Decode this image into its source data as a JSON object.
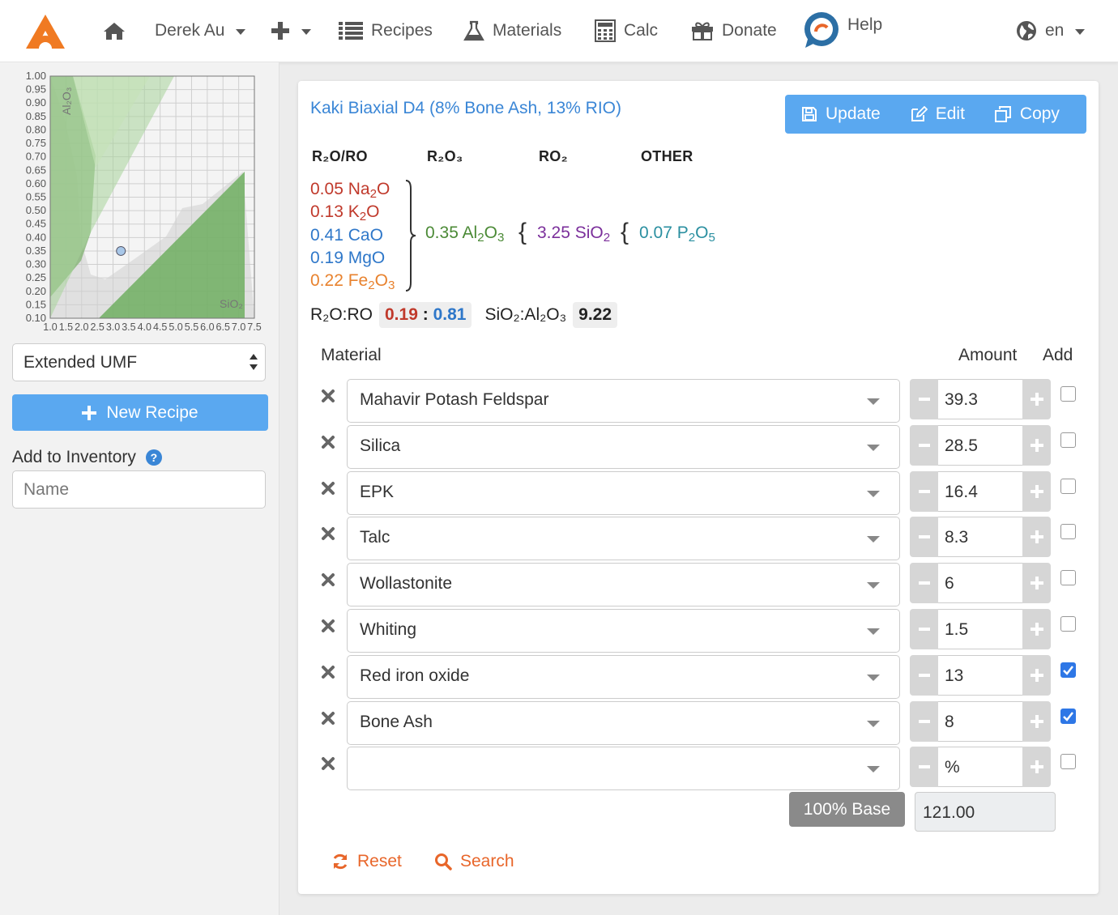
{
  "nav": {
    "user": "Derek Au",
    "recipes": "Recipes",
    "materials": "Materials",
    "calc": "Calc",
    "donate": "Donate",
    "help": "Help",
    "lang": "en",
    "icons": [
      "logo-icon",
      "home-icon",
      "plus-icon",
      "list-icon",
      "flask-icon",
      "calculator-icon",
      "gift-icon",
      "chat-icon",
      "globe-icon"
    ]
  },
  "sidebar": {
    "chart_y_ticks": [
      "1.00",
      "0.95",
      "0.90",
      "0.85",
      "0.80",
      "0.75",
      "0.70",
      "0.65",
      "0.60",
      "0.55",
      "0.50",
      "0.45",
      "0.40",
      "0.35",
      "0.30",
      "0.25",
      "0.20",
      "0.15",
      "0.10"
    ],
    "chart_x_ticks": [
      "1.0",
      "1.5",
      "2.0",
      "2.5",
      "3.0",
      "3.5",
      "4.0",
      "4.5",
      "5.0",
      "5.5",
      "6.0",
      "6.5",
      "7.0",
      "7.5"
    ],
    "chart_y_axis_label": "Al₂O₃",
    "chart_x_axis_label": "SiO₂",
    "point": {
      "SiO2": 3.25,
      "Al2O3": 0.35
    },
    "display_mode": "Extended UMF",
    "new_recipe": "New Recipe",
    "inventory_label": "Add to Inventory",
    "inventory_help": "?",
    "name_placeholder": "Name"
  },
  "recipe": {
    "title": "Kaki Biaxial D4 (8% Bone Ash, 13% RIO)",
    "buttons": {
      "update": "Update",
      "edit": "Edit",
      "copy": "Copy"
    },
    "headers": {
      "r2o": "R₂O/RO",
      "r2o3": "R₂O₃",
      "ro2": "RO₂",
      "other": "OTHER"
    },
    "flux": [
      {
        "val": "0.05",
        "name": "Na",
        "sub": "2",
        "tail": "O",
        "color": "#c0392b"
      },
      {
        "val": "0.13",
        "name": "K",
        "sub": "2",
        "tail": "O",
        "color": "#c0392b"
      },
      {
        "val": "0.41",
        "name": "CaO",
        "sub": "",
        "tail": "",
        "color": "#2e77c9"
      },
      {
        "val": "0.19",
        "name": "MgO",
        "sub": "",
        "tail": "",
        "color": "#2e77c9"
      },
      {
        "val": "0.22",
        "name": "Fe",
        "sub": "2",
        "tail": "O",
        "sub2": "3",
        "color": "#e8822e"
      }
    ],
    "al2o3": "0.35",
    "sio2": "3.25",
    "p2o5": "0.07",
    "ratio_label": "R₂O:RO",
    "ratio_r2o": "0.19",
    "ratio_sep": ":",
    "ratio_ro": "0.81",
    "si_al_label": "SiO₂:Al₂O₃",
    "si_al": "9.22",
    "col_material": "Material",
    "col_amount": "Amount",
    "col_add": "Add",
    "materials": [
      {
        "name": "Mahavir Potash Feldspar",
        "amount": "39.3",
        "add": false
      },
      {
        "name": "Silica",
        "amount": "28.5",
        "add": false
      },
      {
        "name": "EPK",
        "amount": "16.4",
        "add": false
      },
      {
        "name": "Talc",
        "amount": "8.3",
        "add": false
      },
      {
        "name": "Wollastonite",
        "amount": "6",
        "add": false
      },
      {
        "name": "Whiting",
        "amount": "1.5",
        "add": false
      },
      {
        "name": "Red iron oxide",
        "amount": "13",
        "add": true
      },
      {
        "name": "Bone Ash",
        "amount": "8",
        "add": true
      },
      {
        "name": "",
        "amount": "%",
        "add": false
      }
    ],
    "base_label": "100% Base",
    "base_total": "121.00",
    "reset": "Reset",
    "search": "Search"
  }
}
